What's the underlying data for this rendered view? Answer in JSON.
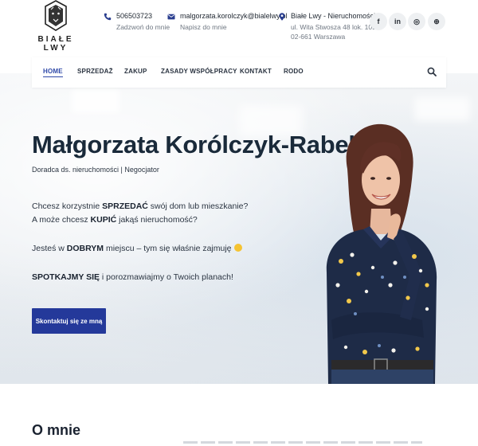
{
  "brand": {
    "logo_text": "BIAŁE LWY"
  },
  "contact": {
    "phone": {
      "value": "506503723",
      "label": "Zadzwoń do mnie",
      "icon": "phone-icon"
    },
    "email": {
      "value": "malgorzata.korolczyk@bialelwy.pl",
      "label": "Napisz do mnie",
      "icon": "envelope-icon"
    },
    "address": {
      "title": "Białe Lwy - Nieruchomości",
      "line1": "ul. Wita Stwosza 48 lok. 109",
      "line2": "02-661 Warszawa",
      "icon": "map-pin-icon"
    }
  },
  "social": [
    {
      "name": "facebook",
      "glyph": "f"
    },
    {
      "name": "linkedin",
      "glyph": "in"
    },
    {
      "name": "instagram",
      "glyph": "◎"
    },
    {
      "name": "website",
      "glyph": "⊕"
    }
  ],
  "nav": {
    "items": [
      {
        "label": "HOME",
        "active": true
      },
      {
        "label": "SPRZEDAŻ"
      },
      {
        "label": "ZAKUP"
      },
      {
        "label": "ZASADY WSPÓŁPRACY"
      },
      {
        "label": "KONTAKT"
      },
      {
        "label": "RODO"
      }
    ],
    "search_icon": "search-icon"
  },
  "hero": {
    "name": "Małgorzata Korólczyk-Rabek",
    "role": "Doradca ds. nieruchomości | Negocjator",
    "line1_pre": "Chcesz korzystnie ",
    "line1_bold": "SPRZEDAĆ",
    "line1_post": " swój dom lub mieszkanie?",
    "line2_pre": "A może chcesz ",
    "line2_bold": "KUPIĆ",
    "line2_post": " jakąś nieruchomość?",
    "line3_pre": "Jesteś w ",
    "line3_bold": "DOBRYM",
    "line3_post": " miejscu – tym się właśnie zajmuję",
    "line4_bold": "SPOTKAJMY SIĘ",
    "line4_post": " i porozmawiajmy o Twoich planach!",
    "cta_label": "Skontaktuj się ze mną"
  },
  "about": {
    "title": "O mnie"
  },
  "colors": {
    "accent": "#24399a",
    "nav_active": "#2f49a8",
    "text_dark": "#1a2a3a"
  }
}
